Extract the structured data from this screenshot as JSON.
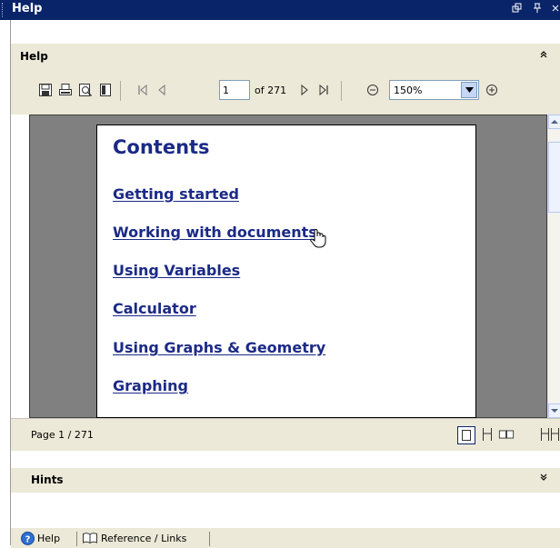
{
  "window": {
    "title": "Help",
    "controls": [
      "restore-icon",
      "pin-icon",
      "close-icon"
    ]
  },
  "help_panel": {
    "header": "Help",
    "toolbar": {
      "page_value": "1",
      "page_of": "of 271",
      "zoom_value": "150%"
    }
  },
  "document": {
    "title": "Contents",
    "toc": [
      "Getting started",
      "Working with documents",
      "Using Variables",
      "Calculator",
      "Using Graphs & Geometry",
      "Graphing"
    ],
    "link_color": "#1b2a86"
  },
  "status": {
    "page_text": "Page 1 / 271"
  },
  "hints": {
    "header": "Hints"
  },
  "bottom_tabs": [
    {
      "label": "Help",
      "icon": "help-circle-icon"
    },
    {
      "label": "Reference / Links",
      "icon": "book-icon"
    }
  ],
  "colors": {
    "titlebar": "#0a246a",
    "panel": "#ece9d8",
    "viewer_bg": "#808080"
  }
}
